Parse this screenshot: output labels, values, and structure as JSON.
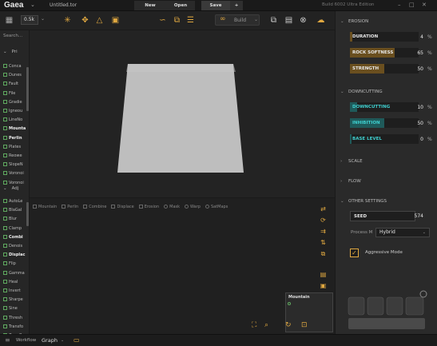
{
  "app": {
    "name": "Gaea",
    "file": "Untitled.tor",
    "build_info": "Build 6002 Ultra Edition"
  },
  "titlebar": {
    "new_label": "New",
    "open_label": "Open",
    "save_label": "Save",
    "add_label": "+"
  },
  "toolbar": {
    "resolution": "0.5k",
    "build_label": "Build"
  },
  "left_panel": {
    "search_placeholder": "Search...",
    "section1": "Pri",
    "primitives": [
      "Conca",
      "Dunes",
      "Fault",
      "File",
      "Gradie",
      "Igneou",
      "LineNo",
      "Mounta",
      "Perlin",
      "Plates",
      "Reowe",
      "SlopeN",
      "Voronoi",
      "Voronoi"
    ],
    "section2": "Adj",
    "adjustments": [
      "AutoLe",
      "BlaGal",
      "Blur",
      "Clamp",
      "Combi",
      "Denois",
      "Displac",
      "Flip",
      "Gamma",
      "Heal",
      "Invert",
      "Sharpe",
      "Sine",
      "Thresh",
      "Transfo",
      "Zero Be"
    ]
  },
  "graph": {
    "tabs": [
      "Mountain",
      "Perlin",
      "Combine",
      "Displace",
      "Erosion",
      "Mask",
      "Warp",
      "SatMaps"
    ],
    "node_name": "Mountain"
  },
  "status": {
    "workflow_label": "Workflow",
    "graph_label": "Graph"
  },
  "properties": {
    "erosion_title": "EROSION",
    "erosion": [
      {
        "label": "DURATION",
        "value": "4",
        "unit": "%",
        "level": 0.04
      },
      {
        "label": "ROCK SOFTNESS",
        "value": "65",
        "unit": "%",
        "level": 0.65
      },
      {
        "label": "STRENGTH",
        "value": "50",
        "unit": "%",
        "level": 0.5
      }
    ],
    "downcutting_title": "DOWNCUTTING",
    "downcutting": [
      {
        "label": "DOWNCUTTING",
        "value": "10",
        "unit": "%",
        "level": 0.1
      },
      {
        "label": "INHIBITION",
        "value": "50",
        "unit": "%",
        "level": 0.5
      },
      {
        "label": "BASE LEVEL",
        "value": "0",
        "unit": "%",
        "level": 0.0
      }
    ],
    "scale_title": "SCALE",
    "flow_title": "FLOW",
    "other_title": "OTHER SETTINGS",
    "seed_label": "SEED",
    "seed_value": "574",
    "process_label": "Process M",
    "process_value": "Hybrid",
    "aggressive_label": "Aggressive Mode",
    "aggressive_checked": true
  },
  "colors": {
    "accent": "#e0a840",
    "erosion_fill": "#6a4f1f",
    "downcut_fill": "#1f5a5a",
    "downcut_text": "#3fd0d0"
  }
}
